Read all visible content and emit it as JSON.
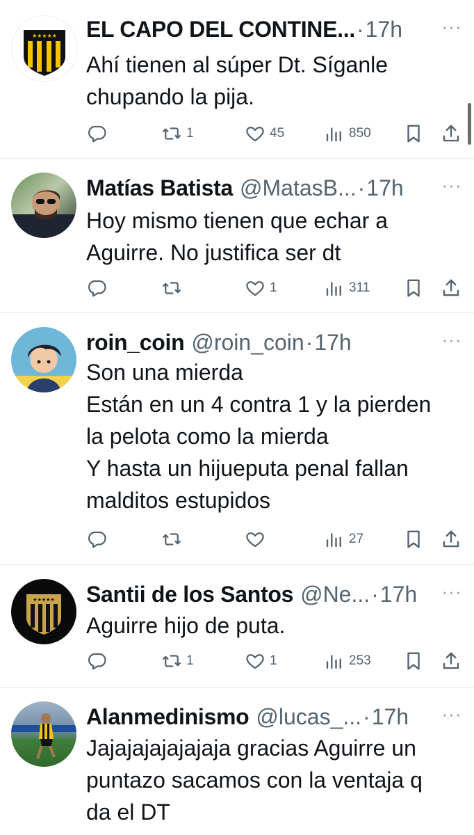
{
  "tweets": [
    {
      "name": "EL CAPO DEL CONTINE...",
      "handle": "",
      "dot": "·",
      "time": "17h",
      "text": "Ahí tienen al súper Dt. Síganle\nchupando la pija.",
      "replies": "",
      "retweets": "1",
      "likes": "45",
      "views": "850",
      "avatar": "penarol-crest"
    },
    {
      "name": "Matías Batista",
      "handle": "@MatasB...",
      "dot": "·",
      "time": "17h",
      "text": "Hoy mismo tienen que echar a\nAguirre. No justifica ser dt",
      "replies": "",
      "retweets": "",
      "likes": "1",
      "views": "311",
      "avatar": "man-sunglasses-photo"
    },
    {
      "name": "roin_coin",
      "handle": "@roin_coin",
      "dot": "·",
      "time": "17h",
      "text": "Son una mierda\nEstán en un 4 contra 1 y la pierden\nla pelota como la mierda\nY hasta un hijueputa penal fallan\nmalditos estupidos",
      "replies": "",
      "retweets": "",
      "likes": "",
      "views": "27",
      "avatar": "anime-boy"
    },
    {
      "name": "Santii de los Santos",
      "handle": "@Ne...",
      "dot": "·",
      "time": "17h",
      "text": "Aguirre hijo de puta.",
      "replies": "",
      "retweets": "1",
      "likes": "1",
      "views": "253",
      "avatar": "penarol-crest-dark"
    },
    {
      "name": "Alanmedinismo",
      "handle": "@lucas_...",
      "dot": "·",
      "time": "17h",
      "text": "Jajajajajajajaja gracias Aguirre un\npuntazo sacamos con la ventaja q\nda el DT",
      "replies": "",
      "retweets": "",
      "likes": "",
      "views": "",
      "avatar": "football-player-photo"
    }
  ],
  "colors": {
    "text": "#0f1419",
    "secondary": "#536471",
    "divider": "#e6e9eb",
    "penarol_yellow": "#f5c400"
  },
  "icons": {
    "reply": "reply-icon",
    "retweet": "retweet-icon",
    "like": "heart-icon",
    "views": "views-icon",
    "bookmark": "bookmark-icon",
    "share": "share-icon",
    "more": "more-icon"
  }
}
